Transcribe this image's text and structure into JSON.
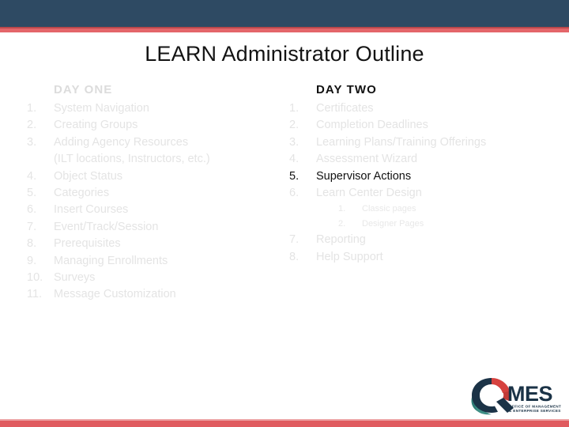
{
  "theme": {
    "header_bar_color": "#2e4a63",
    "accent_rule_color": "#e4666a",
    "footer_rule_color": "#e05b5f",
    "muted_text_color": "#e4e4e4",
    "dark_text_color": "#111111"
  },
  "slide": {
    "title": "LEARN Administrator Outline"
  },
  "columns": [
    {
      "heading": "DAY ONE",
      "heading_emphasis": "muted",
      "items": [
        {
          "num": "1.",
          "text": "System Navigation",
          "emphasis": "muted"
        },
        {
          "num": "2.",
          "text": "Creating Groups",
          "emphasis": "muted"
        },
        {
          "num": "3.",
          "text": "Adding Agency Resources",
          "continuation": "(ILT locations, Instructors, etc.)",
          "emphasis": "muted"
        },
        {
          "num": "4.",
          "text": "Object Status",
          "emphasis": "muted"
        },
        {
          "num": "5.",
          "text": "Categories",
          "emphasis": "muted"
        },
        {
          "num": "6.",
          "text": "Insert Courses",
          "emphasis": "muted"
        },
        {
          "num": "7.",
          "text": "Event/Track/Session",
          "emphasis": "muted"
        },
        {
          "num": "8.",
          "text": "Prerequisites",
          "emphasis": "muted"
        },
        {
          "num": "9.",
          "text": "Managing Enrollments",
          "emphasis": "muted"
        },
        {
          "num": "10.",
          "text": "Surveys",
          "emphasis": "muted"
        },
        {
          "num": "11.",
          "text": "Message Customization",
          "emphasis": "muted"
        }
      ]
    },
    {
      "heading": "DAY TWO",
      "heading_emphasis": "dark",
      "items": [
        {
          "num": "1.",
          "text": "Certificates",
          "emphasis": "muted"
        },
        {
          "num": "2.",
          "text": "Completion Deadlines",
          "emphasis": "muted"
        },
        {
          "num": "3.",
          "text": "Learning Plans/Training Offerings",
          "emphasis": "muted"
        },
        {
          "num": "4.",
          "text": "Assessment Wizard",
          "emphasis": "muted"
        },
        {
          "num": "5.",
          "text": "Supervisor Actions",
          "emphasis": "dark"
        },
        {
          "num": "6.",
          "text": "Learn Center Design",
          "emphasis": "muted",
          "subitems": [
            {
              "num": "1.",
              "text": "Classic pages"
            },
            {
              "num": "2.",
              "text": "Designer Pages"
            }
          ]
        },
        {
          "num": "7.",
          "text": "Reporting",
          "emphasis": "muted"
        },
        {
          "num": "8.",
          "text": "Help Support",
          "emphasis": "muted"
        }
      ]
    }
  ],
  "logo": {
    "wordmark": "MES",
    "tagline_line1": "OFFICE OF MANAGEMENT",
    "tagline_line2": "& ENTERPRISE SERVICES",
    "mark_colors": {
      "teal": "#3f8f86",
      "red": "#d6423f",
      "navy": "#1b3347"
    }
  }
}
